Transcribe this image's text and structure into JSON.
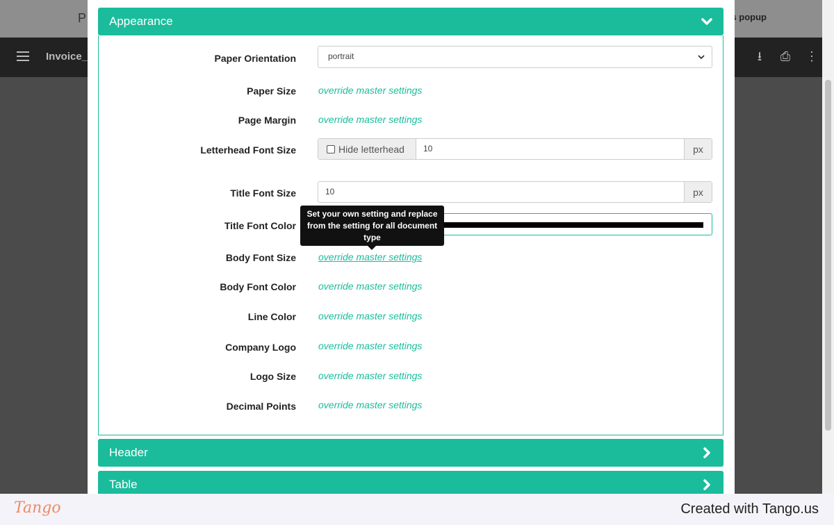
{
  "background": {
    "title_fragment": "P",
    "popup_fragment": "s popup",
    "doc_name": "Invoice_I",
    "tools": {
      "download": "⭳",
      "print": "⎙",
      "more": "⋮"
    }
  },
  "modal": {
    "sections": [
      {
        "label": "Appearance",
        "state": "expanded"
      },
      {
        "label": "Header",
        "state": "collapsed"
      },
      {
        "label": "Table",
        "state": "collapsed"
      }
    ],
    "appearance": {
      "paper_orientation": {
        "label": "Paper Orientation",
        "value": "portrait"
      },
      "paper_size": {
        "label": "Paper Size",
        "link": "override master settings"
      },
      "page_margin": {
        "label": "Page Margin",
        "link": "override master settings"
      },
      "letterhead_font_size": {
        "label": "Letterhead Font Size",
        "checkbox_label": "Hide letterhead",
        "value": "10",
        "unit": "px"
      },
      "title_font_size": {
        "label": "Title Font Size",
        "value": "10",
        "unit": "px"
      },
      "title_font_color": {
        "label": "Title Font Color",
        "value": "#000000"
      },
      "body_font_size": {
        "label": "Body Font Size",
        "link": "override master settings"
      },
      "body_font_color": {
        "label": "Body Font Color",
        "link": "override master settings"
      },
      "line_color": {
        "label": "Line Color",
        "link": "override master settings"
      },
      "company_logo": {
        "label": "Company Logo",
        "link": "override master settings"
      },
      "logo_size": {
        "label": "Logo Size",
        "link": "override master settings"
      },
      "decimal_points": {
        "label": "Decimal Points",
        "link": "override master settings"
      }
    },
    "tooltip": "Set your own setting and replace from the setting for all document type"
  },
  "footer": {
    "logo": "Tango",
    "credit": "Created with Tango.us"
  },
  "colors": {
    "accent": "#1abc9c",
    "tooltip_bg": "#111111",
    "footer_logo": "#ee8b63"
  }
}
